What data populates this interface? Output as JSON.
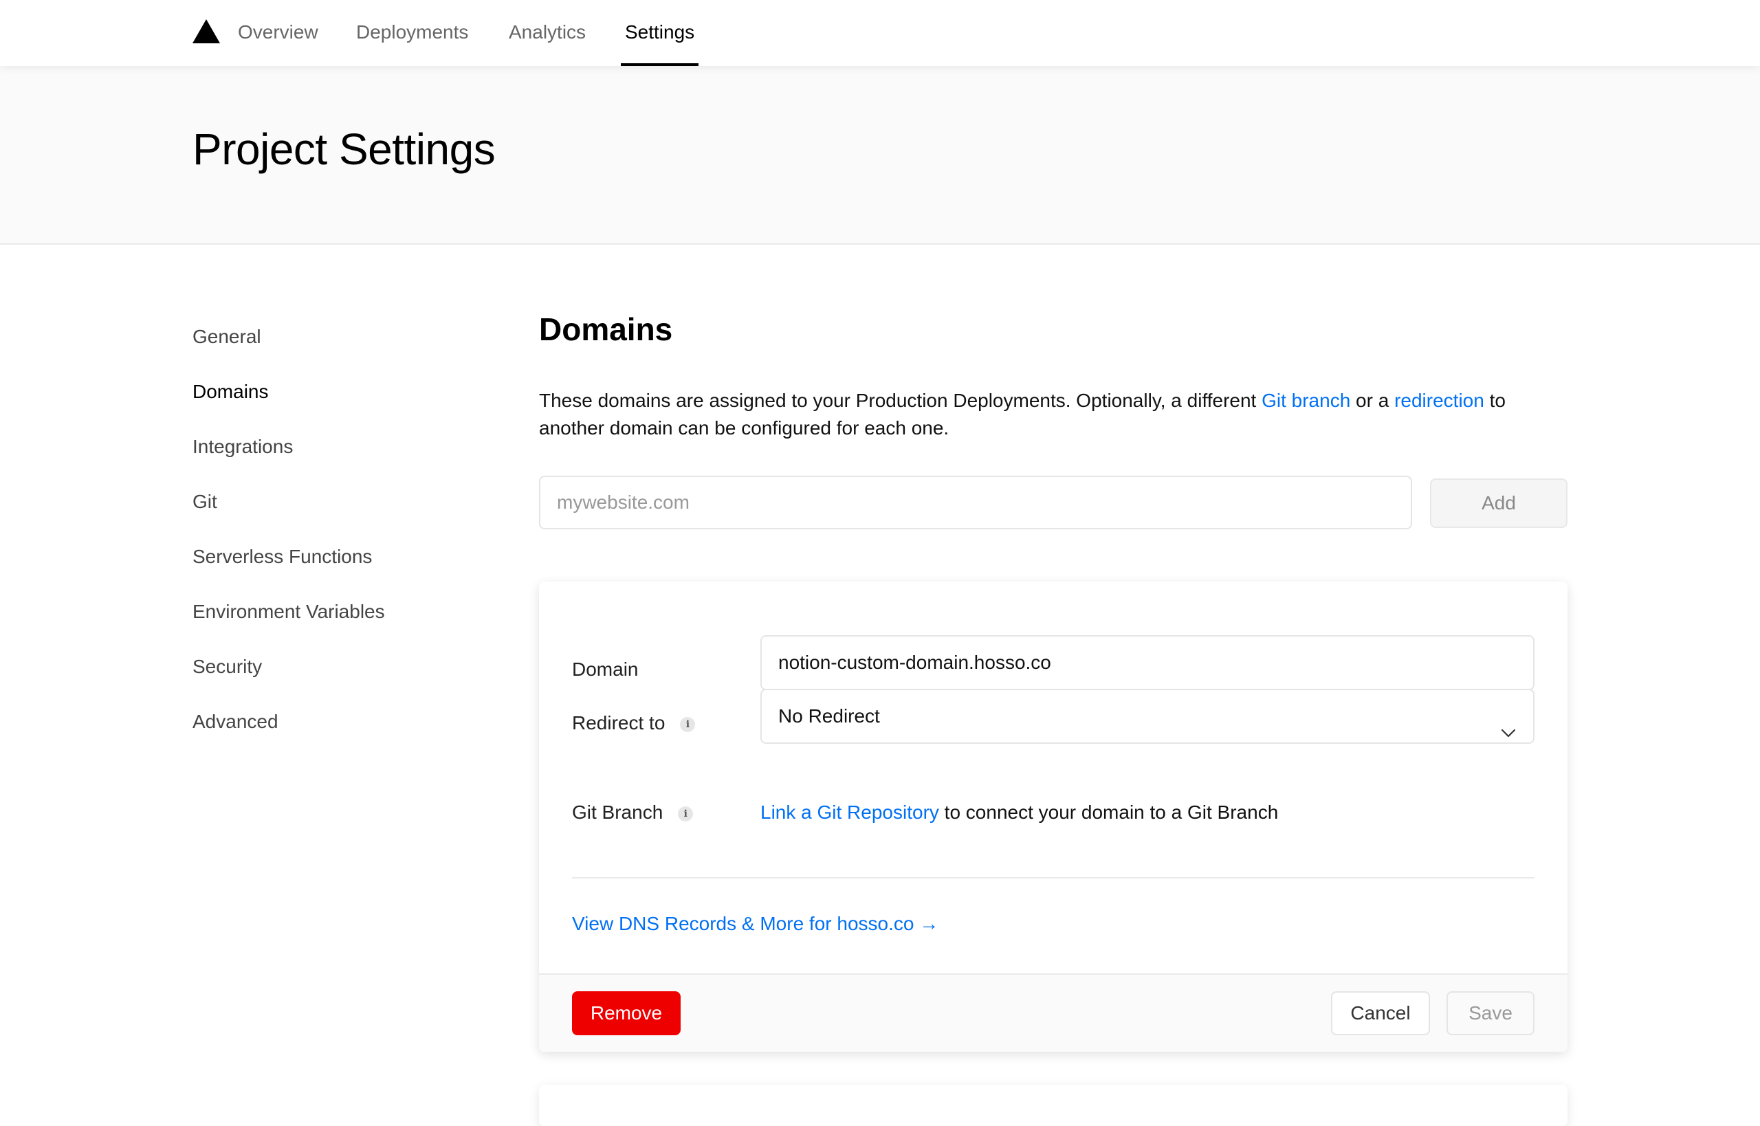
{
  "nav": {
    "tabs": [
      {
        "label": "Overview"
      },
      {
        "label": "Deployments"
      },
      {
        "label": "Analytics"
      },
      {
        "label": "Settings",
        "active": true
      }
    ]
  },
  "hero": {
    "title": "Project Settings"
  },
  "sidebar": {
    "items": [
      {
        "label": "General"
      },
      {
        "label": "Domains",
        "active": true
      },
      {
        "label": "Integrations"
      },
      {
        "label": "Git"
      },
      {
        "label": "Serverless Functions"
      },
      {
        "label": "Environment Variables"
      },
      {
        "label": "Security"
      },
      {
        "label": "Advanced"
      }
    ]
  },
  "domains": {
    "title": "Domains",
    "description": {
      "part1": "These domains are assigned to your Production Deployments. Optionally, a different ",
      "link1": "Git branch",
      "part2": " or a ",
      "link2": "redirection",
      "part3": " to another domain can be configured for each one."
    },
    "input_placeholder": "mywebsite.com",
    "add_label": "Add"
  },
  "card": {
    "domain_label": "Domain",
    "domain_value": "notion-custom-domain.hosso.co",
    "redirect_label": "Redirect to",
    "redirect_value": "No Redirect",
    "git_label": "Git Branch",
    "git_link": "Link a Git Repository",
    "git_text": " to connect your domain to a Git Branch",
    "dns_link": "View DNS Records & More for hosso.co →",
    "remove_label": "Remove",
    "cancel_label": "Cancel",
    "save_label": "Save"
  },
  "colors": {
    "accent_link": "#0070f3",
    "danger": "#ee0000"
  }
}
